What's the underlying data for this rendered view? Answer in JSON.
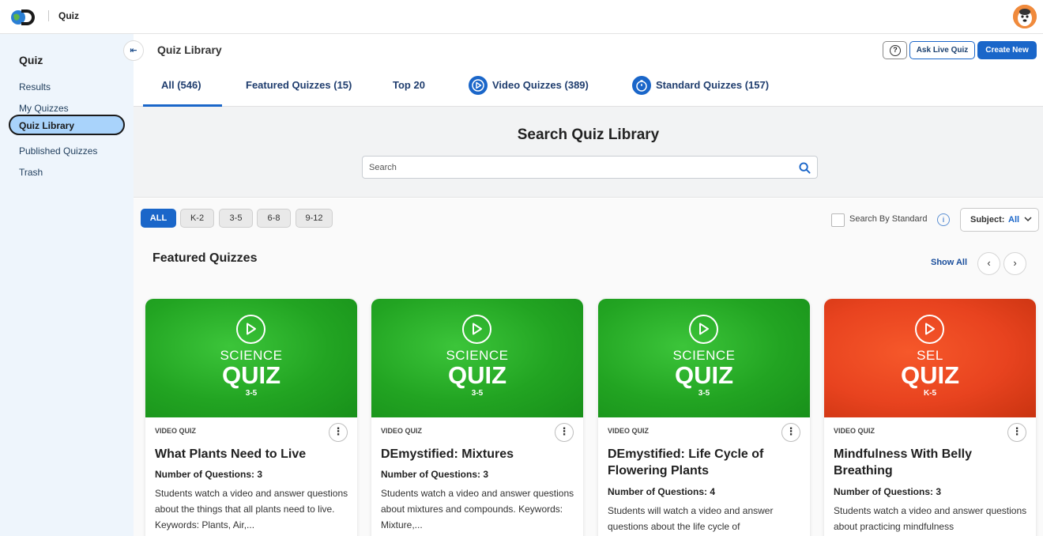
{
  "app": {
    "title": "Quiz"
  },
  "sidebar": {
    "heading": "Quiz",
    "items": [
      {
        "label": "Results"
      },
      {
        "label": "My Quizzes"
      },
      {
        "label": "Quiz Library"
      },
      {
        "label": "Published Quizzes"
      },
      {
        "label": "Trash"
      }
    ],
    "active_item": "Quiz Library"
  },
  "header": {
    "page_title": "Quiz Library",
    "help_label": "?",
    "ask_label": "Ask Live Quiz",
    "create_label": "Create New"
  },
  "tabs": [
    {
      "label": "All (546)",
      "active": true
    },
    {
      "label": "Featured Quizzes (15)",
      "active": false
    },
    {
      "label": "Top 20",
      "active": false
    },
    {
      "label": "Video Quizzes (389)",
      "active": false,
      "icon": "play-icon"
    },
    {
      "label": "Standard Quizzes (157)",
      "active": false,
      "icon": "stopwatch-icon"
    }
  ],
  "search": {
    "title": "Search Quiz Library",
    "placeholder": "Search",
    "value": ""
  },
  "filters": {
    "grades": [
      "ALL",
      "K-2",
      "3-5",
      "6-8",
      "9-12"
    ],
    "active_grade": "ALL",
    "standard_label": "Search By Standard",
    "info_label": "i",
    "subject_key": "Subject:",
    "subject_value": "All"
  },
  "featured": {
    "title": "Featured Quizzes",
    "show_all": "Show All",
    "cards": [
      {
        "subject": "SCIENCE",
        "quiz_word": "QUIZ",
        "grade": "3-5",
        "type": "VIDEO QUIZ",
        "title": "What Plants Need to Live",
        "count": "Number of Questions: 3",
        "description": "Students watch a video and answer questions about the things that all plants need to live. Keywords: Plants, Air,...",
        "color": "green"
      },
      {
        "subject": "SCIENCE",
        "quiz_word": "QUIZ",
        "grade": "3-5",
        "type": "VIDEO QUIZ",
        "title": "DEmystified: Mixtures",
        "count": "Number of Questions: 3",
        "description": "Students watch a video and answer questions about mixtures and compounds. Keywords: Mixture,...",
        "color": "green"
      },
      {
        "subject": "SCIENCE",
        "quiz_word": "QUIZ",
        "grade": "3-5",
        "type": "VIDEO QUIZ",
        "title": "DEmystified: Life Cycle of Flowering Plants",
        "count": "Number of Questions: 4",
        "description": "Students will watch a video and answer questions about the life cycle of",
        "color": "green"
      },
      {
        "subject": "SEL",
        "quiz_word": "QUIZ",
        "grade": "K-5",
        "type": "VIDEO QUIZ",
        "title": "Mindfulness With Belly Breathing",
        "count": "Number of Questions: 3",
        "description": "Students watch a video and answer questions about practicing mindfulness",
        "color": "orange"
      }
    ]
  },
  "colors": {
    "accent": "#1a66c9",
    "sidebar_bg": "#eef5fc",
    "active_item_bg": "#a9d3fb",
    "card_green": "#22a422",
    "card_orange": "#e8431f"
  }
}
